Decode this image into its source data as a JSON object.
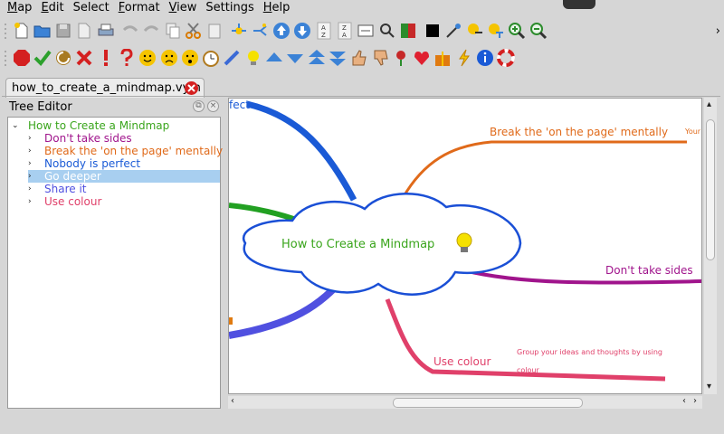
{
  "menubar": {
    "items": [
      {
        "first": "M",
        "rest": "ap"
      },
      {
        "first": "E",
        "rest": "dit"
      },
      {
        "first": "",
        "rest": "Select"
      },
      {
        "first": "F",
        "rest": "ormat"
      },
      {
        "first": "V",
        "rest": "iew"
      },
      {
        "first": "",
        "rest": "Settings"
      },
      {
        "first": "H",
        "rest": "elp"
      }
    ]
  },
  "toolbar": {
    "overflow": "›"
  },
  "tab": {
    "label": "how_to_create_a_mindmap.vym"
  },
  "tree_editor": {
    "title": "Tree Editor",
    "root": "How to Create a Mindmap",
    "items": [
      "Don't take sides",
      "Break the 'on the page' mentally",
      "Nobody is perfect",
      "Go deeper",
      "Share it",
      "Use colour"
    ]
  },
  "mindmap": {
    "central": "How to Create a Mindmap",
    "branches": {
      "top_right": "Break the 'on the page' mentally",
      "top_right_sub": "Your",
      "right": "Don't take sides",
      "bottom": "Use colour",
      "bottom_note_line1": "Group your ideas and thoughts by using",
      "bottom_note_line2": "colour",
      "top_left": "fect"
    }
  },
  "colors": {
    "root": "#3aa51c",
    "dont_take_sides": "#a0148c",
    "break": "#e06a1a",
    "nobody": "#1a5ad6",
    "go_deeper": "#ffffff",
    "share": "#5050e0",
    "use_colour": "#e0406a",
    "cloud": "#1a4fd6"
  }
}
